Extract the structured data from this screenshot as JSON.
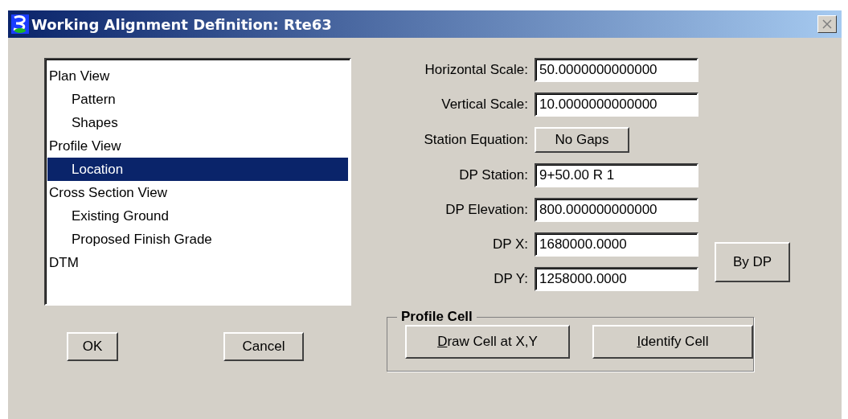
{
  "window": {
    "title": "Working Alignment Definition: Rte63"
  },
  "tree": [
    {
      "label": "Plan View",
      "selected": false,
      "children": [
        {
          "label": "Pattern",
          "selected": false
        },
        {
          "label": "Shapes",
          "selected": false
        }
      ]
    },
    {
      "label": "Profile View",
      "selected": false,
      "children": [
        {
          "label": "Location",
          "selected": true
        }
      ]
    },
    {
      "label": "Cross Section View",
      "selected": false,
      "children": [
        {
          "label": "Existing Ground",
          "selected": false
        },
        {
          "label": "Proposed Finish Grade",
          "selected": false
        }
      ]
    },
    {
      "label": "DTM",
      "selected": false
    }
  ],
  "fields": [
    {
      "kind": "input",
      "label": "Horizontal Scale:",
      "value": "50.0000000000000"
    },
    {
      "kind": "input",
      "label": "Vertical Scale:",
      "value": "10.0000000000000"
    },
    {
      "kind": "button",
      "label": "Station Equation:",
      "value": "No Gaps"
    },
    {
      "kind": "input",
      "label": "DP Station:",
      "value": "9+50.00 R 1"
    },
    {
      "kind": "input",
      "label": "DP Elevation:",
      "value": "800.000000000000"
    },
    {
      "kind": "input",
      "label": "DP X:",
      "value": "1680000.0000"
    },
    {
      "kind": "input",
      "label": "DP Y:",
      "value": "1258000.0000"
    }
  ],
  "by_dp_button": "By DP",
  "buttons": [
    "OK",
    "Cancel"
  ],
  "profile_cell": {
    "title": "Profile Cell",
    "buttons": [
      {
        "label": "Draw Cell at X,Y",
        "first_letter_underlined": true
      },
      {
        "label": "Identify Cell",
        "first_letter_underlined": true
      }
    ]
  }
}
